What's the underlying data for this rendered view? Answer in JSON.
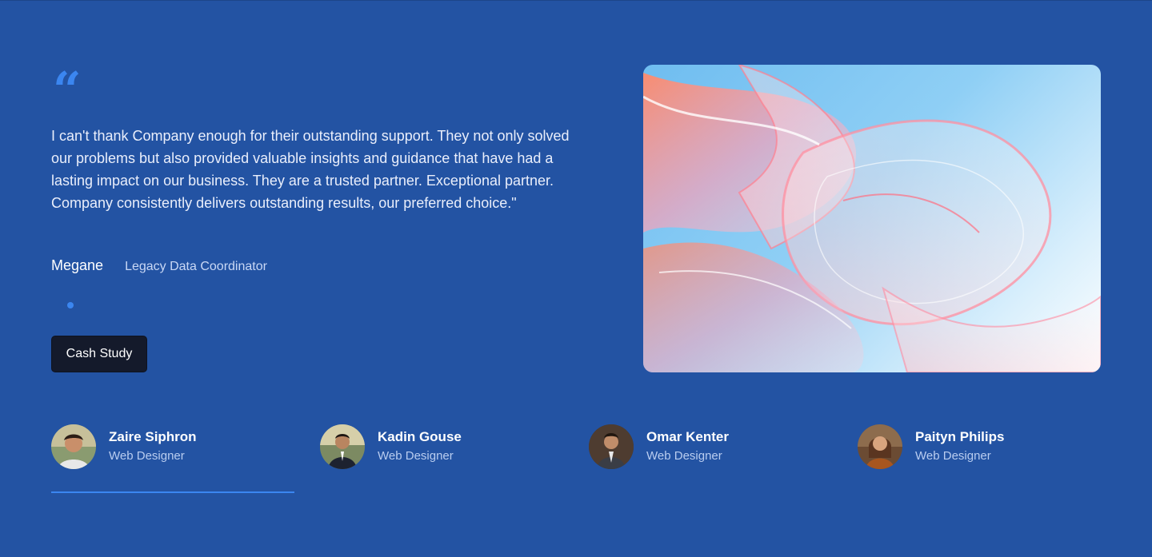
{
  "testimonial": {
    "quote": "I can't thank Company enough for their outstanding support. They not only solved our problems but also provided valuable insights and guidance that have had a lasting impact on our business. They are a trusted partner. Exceptional partner. Company consistently delivers outstanding results, our preferred choice.\"",
    "author_name": "Megane",
    "author_role": "Legacy Data Coordinator",
    "quote_icon": "quote-icon",
    "button_label": "Cash Study"
  },
  "people": [
    {
      "name": "Zaire Siphron",
      "role": "Web Designer",
      "active": true
    },
    {
      "name": "Kadin Gouse",
      "role": "Web Designer",
      "active": false
    },
    {
      "name": "Omar Kenter",
      "role": "Web Designer",
      "active": false
    },
    {
      "name": "Paityn Philips",
      "role": "Web Designer",
      "active": false
    }
  ],
  "colors": {
    "background": "#2353a3",
    "accent": "#3b86f0",
    "button": "#141a2b"
  }
}
